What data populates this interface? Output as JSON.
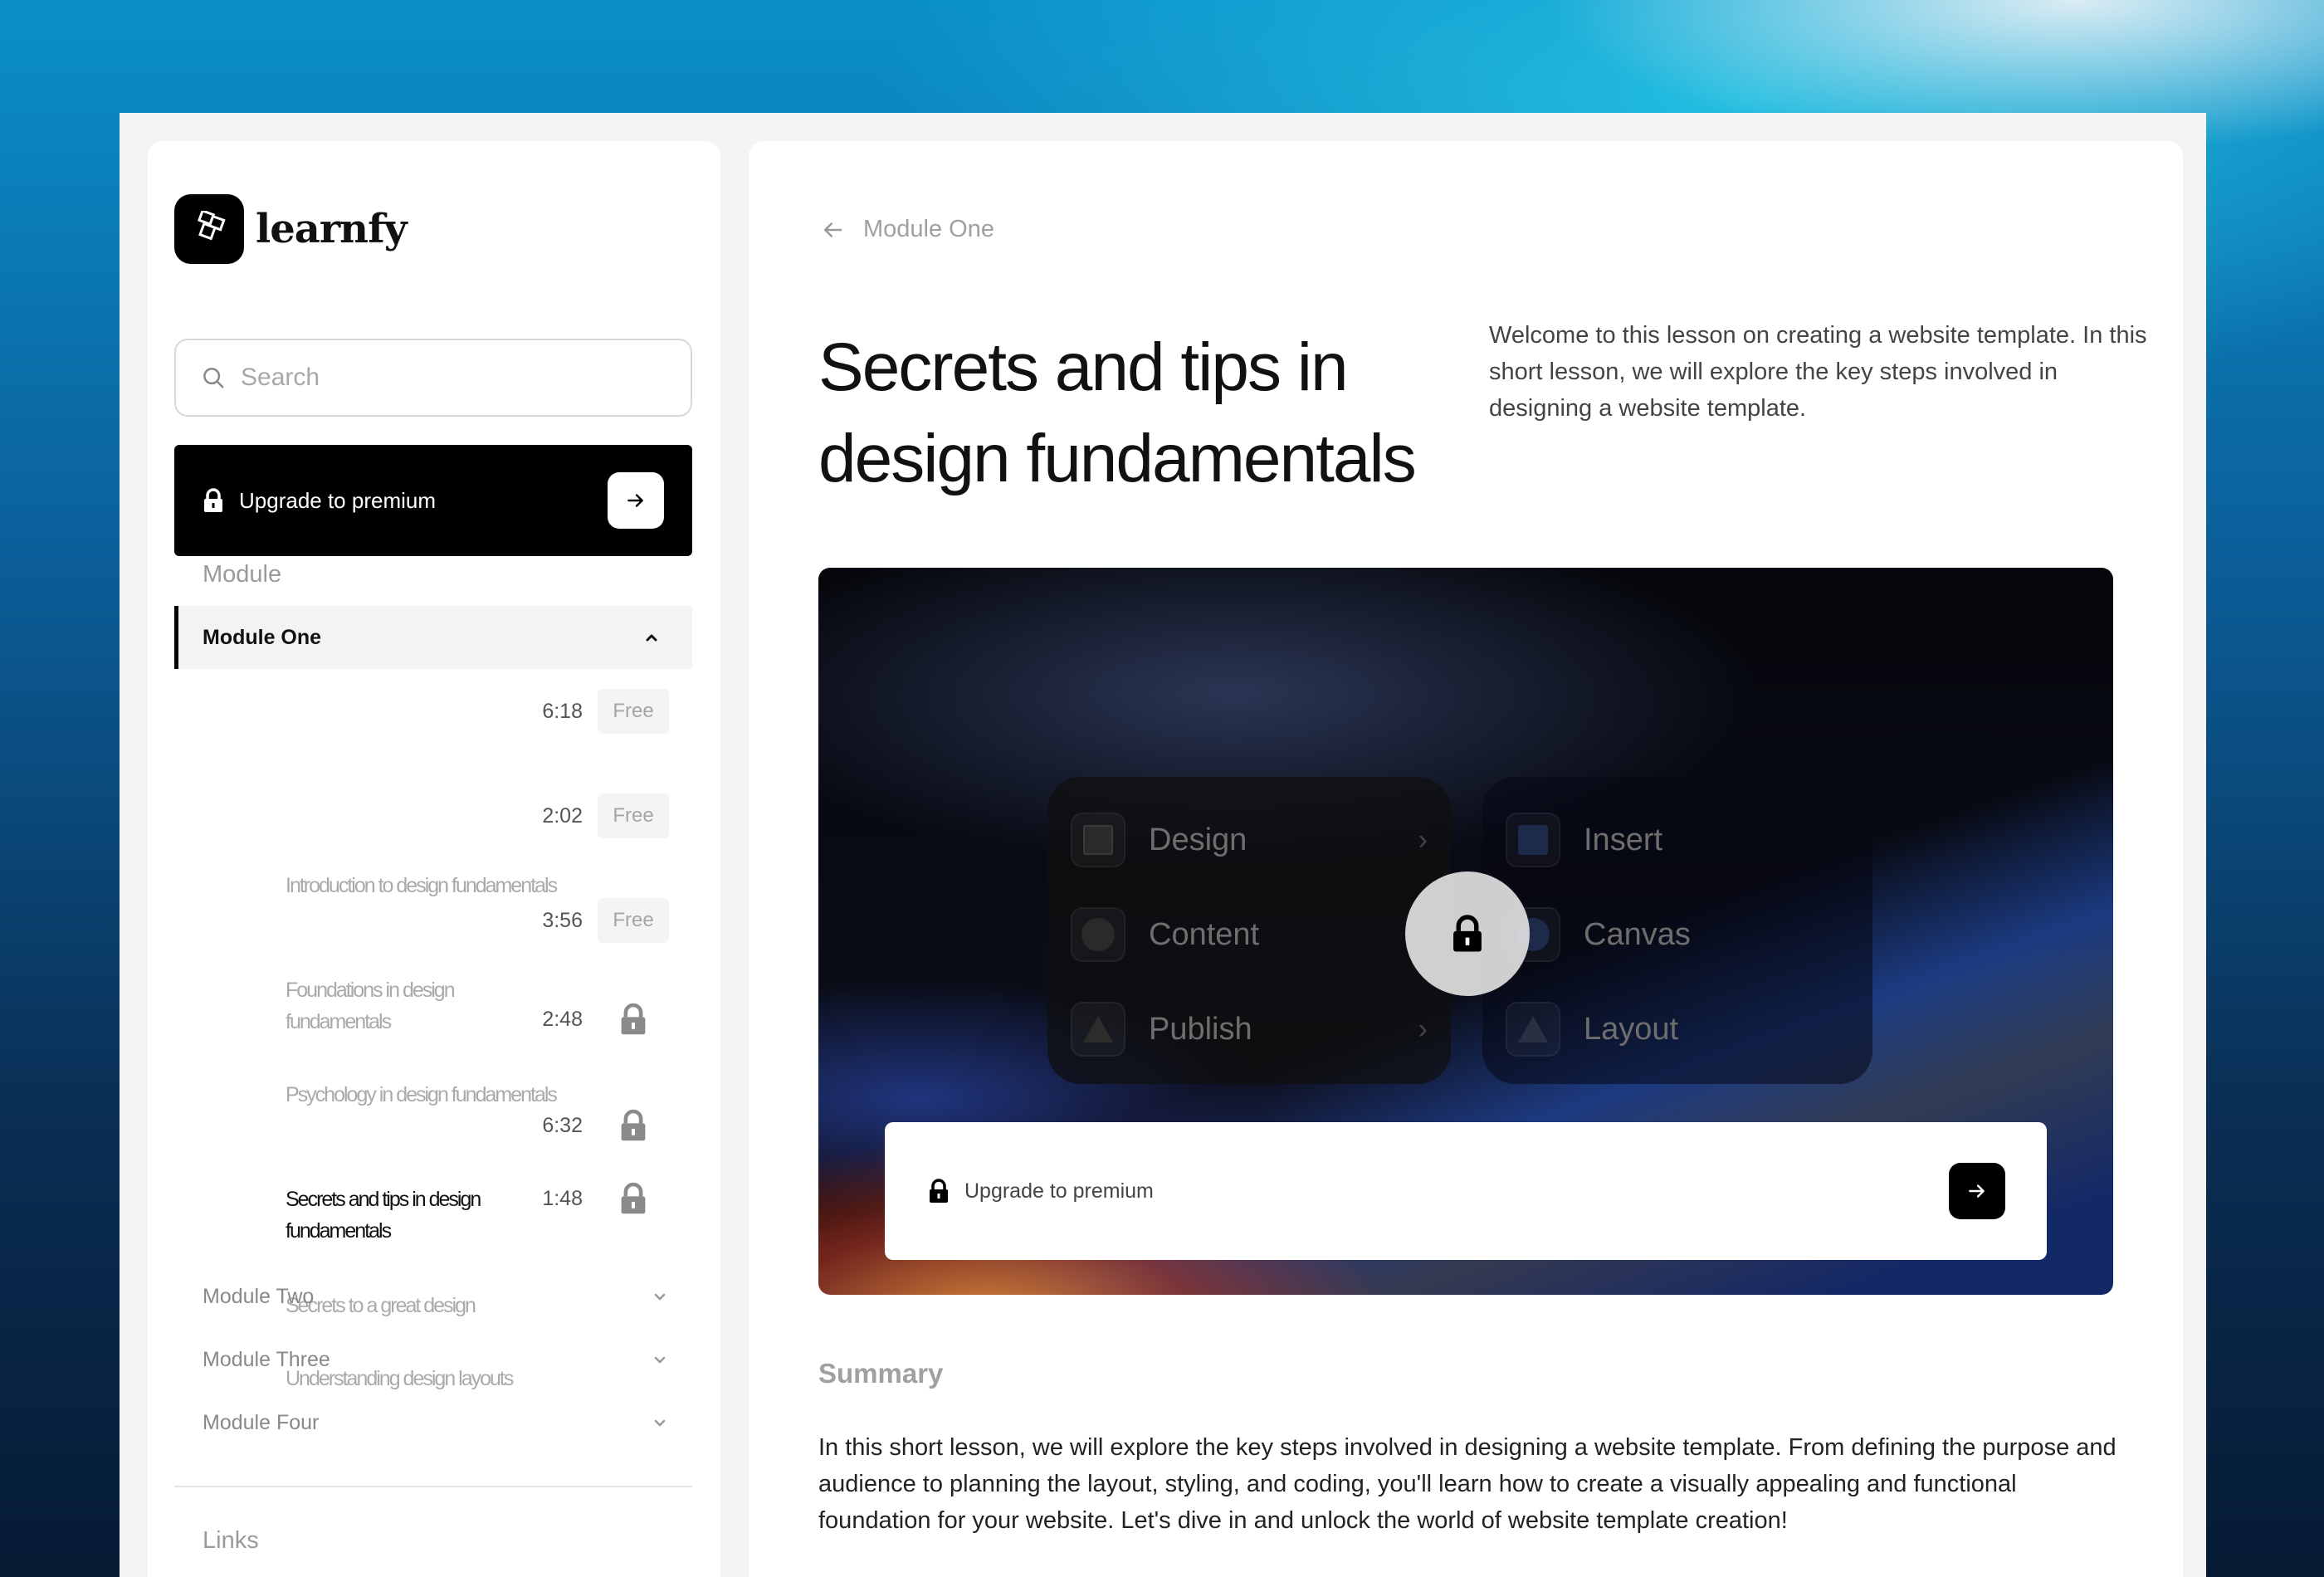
{
  "brand": {
    "name": "learnfy",
    "logo_icon": "stacked-squares-logo-icon"
  },
  "search": {
    "placeholder": "Search",
    "value": ""
  },
  "sidebar": {
    "upgrade": {
      "label": "Upgrade to premium",
      "icon": "lock-icon",
      "action_icon": "arrow-right-icon"
    },
    "module_section_label": "Module",
    "links_section_label": "Links",
    "modules": [
      {
        "name": "Module One",
        "expanded": true,
        "lessons": [
          {
            "title": "Introduction to design fundamentals",
            "duration": "6:18",
            "badge": "Free",
            "locked": false,
            "active": false
          },
          {
            "title": "Foundations in design fundamentals",
            "duration": "2:02",
            "badge": "Free",
            "locked": false,
            "active": false
          },
          {
            "title": "Psychology in design fundamentals",
            "duration": "3:56",
            "badge": "Free",
            "locked": false,
            "active": false
          },
          {
            "title": "Secrets and tips in design fundamentals",
            "duration": "2:48",
            "badge": "",
            "locked": true,
            "active": true
          },
          {
            "title": "Secrets to a great design",
            "duration": "6:32",
            "badge": "",
            "locked": true,
            "active": false
          },
          {
            "title": "Understanding design layouts",
            "duration": "1:48",
            "badge": "",
            "locked": true,
            "active": false
          }
        ]
      },
      {
        "name": "Module Two",
        "expanded": false
      },
      {
        "name": "Module Three",
        "expanded": false
      },
      {
        "name": "Module Four",
        "expanded": false
      }
    ]
  },
  "main": {
    "back_label": "Module One",
    "title": "Secrets and tips in design fundamentals",
    "intro": "Welcome to this lesson on creating a website template. In this short lesson, we will explore the key steps involved in designing a website template.",
    "video": {
      "menu_left": [
        {
          "label": "Design",
          "icon": "square-icon"
        },
        {
          "label": "Content",
          "icon": "circle-icon"
        },
        {
          "label": "Publish",
          "icon": "triangle-icon"
        }
      ],
      "menu_right": [
        {
          "label": "Insert",
          "icon": "square-icon"
        },
        {
          "label": "Canvas",
          "icon": "circle-icon"
        },
        {
          "label": "Layout",
          "icon": "triangle-icon"
        }
      ],
      "cta_label": "Upgrade to premium"
    },
    "summary_heading": "Summary",
    "summary_text": "In this short lesson, we will explore the key steps involved in designing a website template. From defining the purpose and audience to planning the layout, styling, and coding, you'll learn how to create a visually appealing and functional foundation for your website. Let's dive in and unlock the world of website template creation!"
  },
  "colors": {
    "accent": "#000000",
    "muted_text": "#a0a0a0",
    "panel_bg": "#f4f4f4"
  }
}
